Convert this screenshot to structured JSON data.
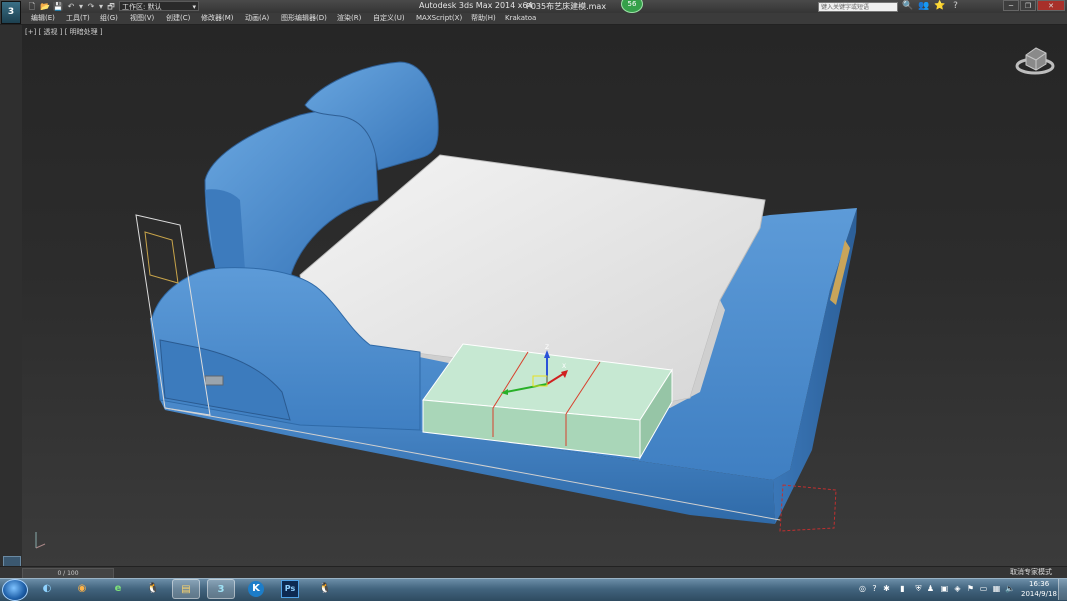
{
  "app": {
    "logo_text": "3",
    "title": "Autodesk 3ds Max  2014 x64",
    "file": "P035布艺床建模.max",
    "badge": "56"
  },
  "quick_access": [
    "🗋",
    "📂",
    "💾",
    "↶",
    "▾",
    "↷",
    "▾",
    "🗗",
    "▾"
  ],
  "workspace": {
    "label": "工作区: 默认"
  },
  "search": {
    "placeholder": "键入关键字或短语"
  },
  "title_icons": [
    "🔍",
    "👥",
    "⭐",
    "?"
  ],
  "window_controls": {
    "minimize": "─",
    "restore": "❐",
    "close": "✕"
  },
  "menu": [
    "编辑(E)",
    "工具(T)",
    "组(G)",
    "视图(V)",
    "创建(C)",
    "修改器(M)",
    "动画(A)",
    "图形编辑器(D)",
    "渲染(R)",
    "自定义(U)",
    "MAXScript(X)",
    "帮助(H)",
    "Krakatoa"
  ],
  "viewport": {
    "label": "[+] [ 透视 ] [ 明暗处理 ]",
    "gizmo_labels": {
      "z": "Z",
      "x": "X"
    }
  },
  "trackbar": {
    "frame": "0 / 100"
  },
  "status": {
    "text": "取消专家模式"
  },
  "taskbar": {
    "apps": [
      {
        "name": "media",
        "glyph": "◐",
        "color": "#2e9ad8"
      },
      {
        "name": "chrome",
        "glyph": "◉",
        "color": "#e0533a"
      },
      {
        "name": "ie",
        "glyph": "e",
        "color": "#3aa44f"
      },
      {
        "name": "qq",
        "glyph": "🐧",
        "color": "#2c2c2c"
      },
      {
        "name": "explorer",
        "glyph": "▤",
        "color": "#e8c35a"
      },
      {
        "name": "3dsmax",
        "glyph": "3",
        "color": "#2a6f86"
      },
      {
        "name": "k-app",
        "glyph": "K",
        "color": "#2b8fd6"
      },
      {
        "name": "photoshop",
        "glyph": "Ps",
        "color": "#12315c"
      },
      {
        "name": "qq2",
        "glyph": "🐧",
        "color": "#2c2c2c"
      }
    ],
    "clock_time": "16:36",
    "clock_date": "2014/9/18"
  },
  "colors": {
    "bed_blue": "#4d8ccf",
    "mattress": "#ececec",
    "selection_box": "#bde3c9"
  }
}
